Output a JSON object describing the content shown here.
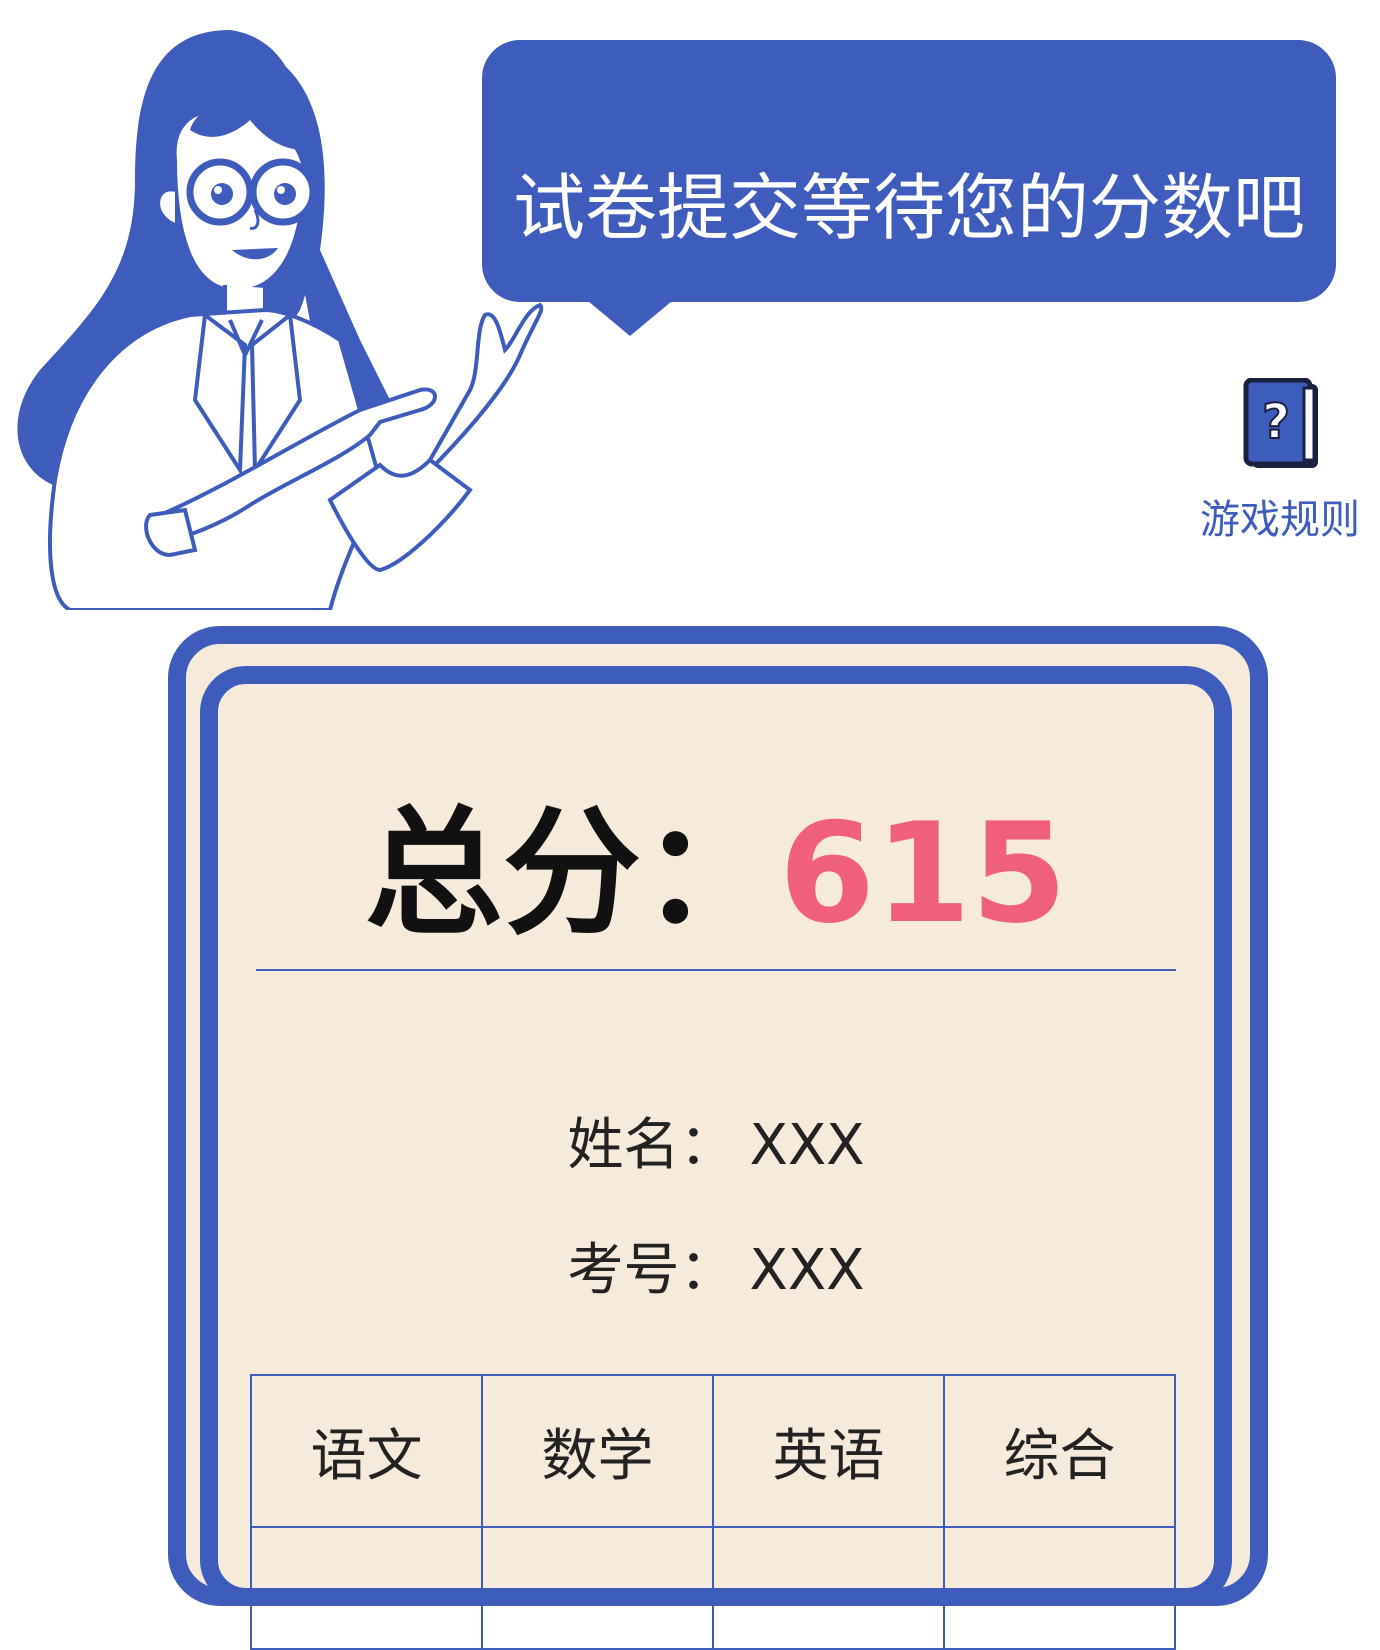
{
  "bubble": {
    "text": "试卷提交等待您的分数吧"
  },
  "rules_link": {
    "label": "游戏规则",
    "icon": "question-book-icon"
  },
  "score_card": {
    "total_label": "总分：",
    "total_value": "615",
    "name_label": "姓名：",
    "name_value": "XXX",
    "exam_no_label": "考号：",
    "exam_no_value": "XXX",
    "subjects": [
      "语文",
      "数学",
      "英语",
      "综合"
    ]
  },
  "colors": {
    "primary": "#3d5cbc",
    "card_bg": "#f6eadb",
    "score": "#f0607a"
  }
}
